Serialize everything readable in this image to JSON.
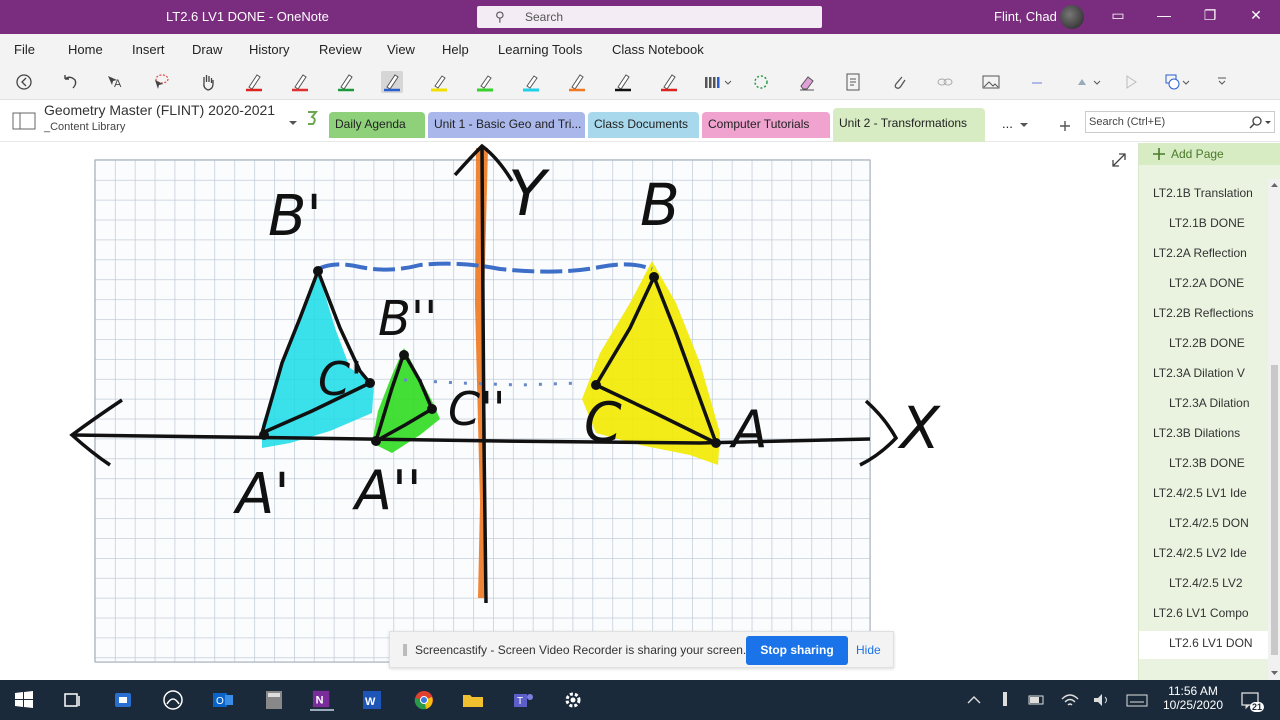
{
  "window": {
    "title": "LT2.6 LV1 DONE  -  OneNote",
    "search_label": "Search",
    "user": "Flint, Chad"
  },
  "menu": [
    "File",
    "Home",
    "Insert",
    "Draw",
    "History",
    "Review",
    "View",
    "Help",
    "Learning Tools",
    "Class Notebook"
  ],
  "notebook": {
    "title": "Geometry Master (FLINT) 2020-2021",
    "subtitle": "_Content Library",
    "tabs": [
      {
        "label": "Daily Agenda",
        "color": "#8fd17a"
      },
      {
        "label": "Unit 1 - Basic Geo and Tri...",
        "color": "#a9b7ea"
      },
      {
        "label": "Class Documents",
        "color": "#a8d8ec"
      },
      {
        "label": "Computer Tutorials",
        "color": "#f0a3cf"
      },
      {
        "label": "Unit 2 - Transformations",
        "color": "#d8ecc4"
      }
    ],
    "more_label": "...",
    "search_placeholder": "Search (Ctrl+E)"
  },
  "pages": {
    "add_label": "Add Page",
    "items": [
      {
        "label": "LT2.1B Translation",
        "sub": false
      },
      {
        "label": "LT2.1B DONE",
        "sub": true
      },
      {
        "label": "LT2.2A Reflection",
        "sub": false
      },
      {
        "label": "LT2.2A DONE",
        "sub": true
      },
      {
        "label": "LT2.2B Reflections",
        "sub": false
      },
      {
        "label": "LT2.2B DONE",
        "sub": true
      },
      {
        "label": "LT2.3A Dilation V",
        "sub": false
      },
      {
        "label": "LT2.3A Dilation",
        "sub": true
      },
      {
        "label": "LT2.3B Dilations",
        "sub": false
      },
      {
        "label": "LT2.3B DONE",
        "sub": true
      },
      {
        "label": "LT2.4/2.5 LV1 Ide",
        "sub": false
      },
      {
        "label": "LT2.4/2.5 DON",
        "sub": true
      },
      {
        "label": "LT2.4/2.5 LV2 Ide",
        "sub": false
      },
      {
        "label": "LT2.4/2.5 LV2",
        "sub": true
      },
      {
        "label": "LT2.6 LV1 Compo",
        "sub": false
      },
      {
        "label": "LT2.6 LV1 DON",
        "sub": true,
        "current": true
      }
    ]
  },
  "ink": {
    "y_axis": "Y",
    "x_axis": "X",
    "B_prime": "B'",
    "B": "B",
    "B_double": "B''",
    "C_prime": "C'",
    "C_double": "C''",
    "C": "C",
    "A_prime": "A'",
    "A_double": "A''",
    "A": "A"
  },
  "notice": {
    "message": "Screencastify - Screen Video Recorder is sharing your screen.",
    "stop_label": "Stop sharing",
    "hide_label": "Hide"
  },
  "taskbar": {
    "time": "11:56 AM",
    "date": "10/25/2020",
    "notif_count": "21"
  }
}
